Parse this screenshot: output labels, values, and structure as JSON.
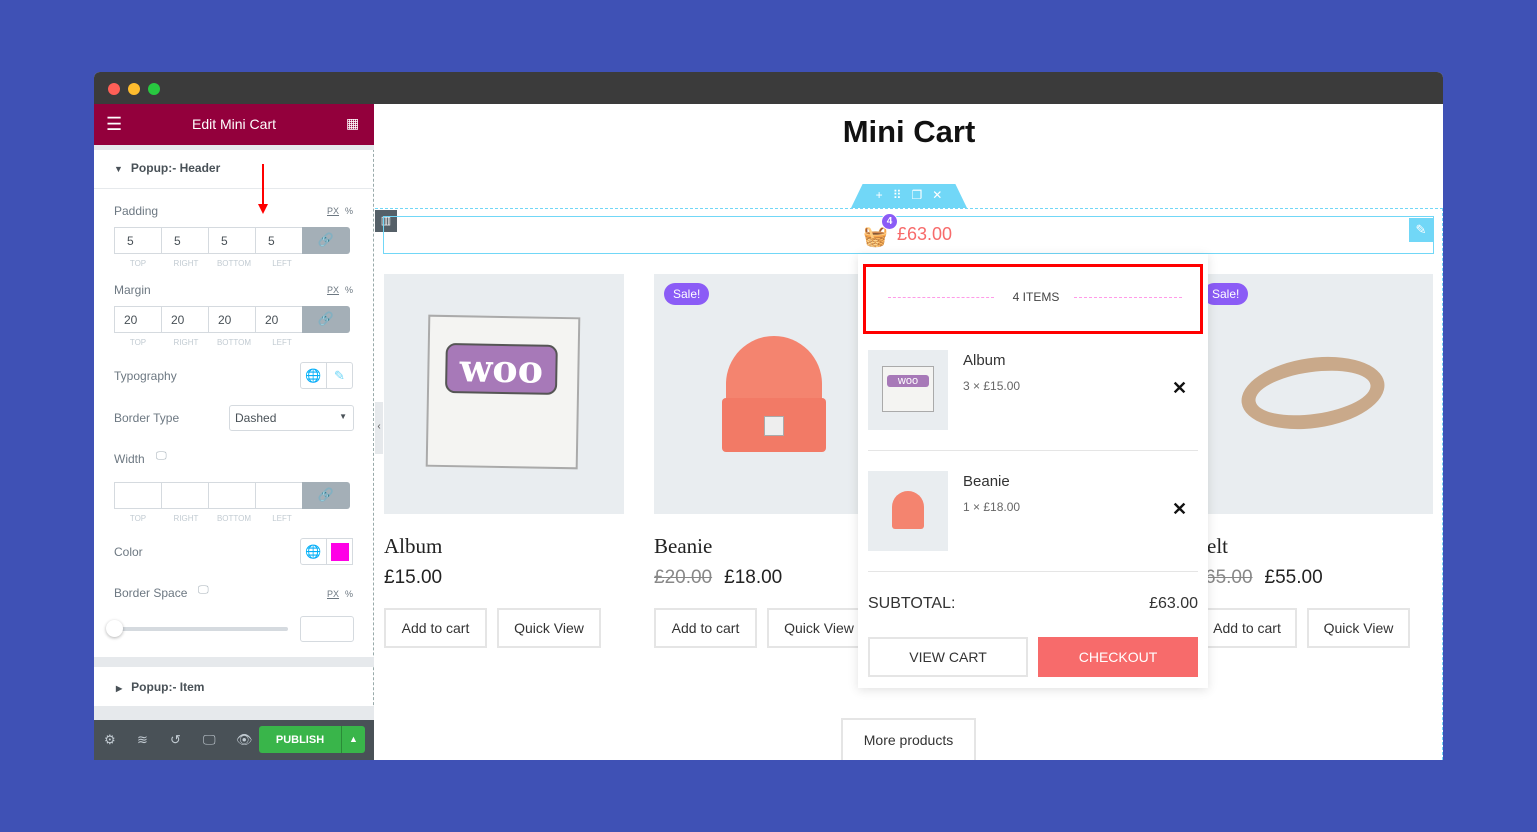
{
  "panel": {
    "title": "Edit Mini Cart",
    "section_header": "Popup:- Header",
    "section_item": "Popup:- Item",
    "padding": {
      "label": "Padding",
      "unit_px": "PX",
      "unit_pct": "%",
      "values": [
        "5",
        "5",
        "5",
        "5"
      ]
    },
    "margin": {
      "label": "Margin",
      "unit_px": "PX",
      "unit_pct": "%",
      "values": [
        "20",
        "20",
        "20",
        "20"
      ]
    },
    "sides": [
      "TOP",
      "RIGHT",
      "BOTTOM",
      "LEFT"
    ],
    "typography": "Typography",
    "border_type": {
      "label": "Border Type",
      "value": "Dashed"
    },
    "width": {
      "label": "Width"
    },
    "color": {
      "label": "Color",
      "value": "#ff00e6"
    },
    "border_space": {
      "label": "Border Space",
      "unit_px": "PX",
      "unit_pct": "%",
      "value": 0
    },
    "publish": "PUBLISH"
  },
  "page": {
    "title": "Mini Cart",
    "cart_count": "4",
    "cart_total": "£63.00",
    "more": "More products"
  },
  "products": [
    {
      "name": "Album",
      "price": "£15.00",
      "old": "",
      "sale": "",
      "add": "Add to cart",
      "qv": "Quick View"
    },
    {
      "name": "Beanie",
      "price": "£18.00",
      "old": "£20.00",
      "sale": "Sale!",
      "add": "Add to cart",
      "qv": "Quick View"
    },
    {
      "name": "elt",
      "price": "£55.00",
      "old": "65.00",
      "sale": "Sale!",
      "add": "Add to cart",
      "qv": "Quick View"
    }
  ],
  "popup": {
    "header": "4 ITEMS",
    "items": [
      {
        "name": "Album",
        "qty": "3 × £15.00"
      },
      {
        "name": "Beanie",
        "qty": "1 × £18.00"
      }
    ],
    "subtotal_label": "SUBTOTAL:",
    "subtotal": "£63.00",
    "view_cart": "VIEW CART",
    "checkout": "CHECKOUT"
  },
  "colors": {
    "panel_header": "#93003c",
    "accent": "#f76b6b",
    "badge": "#8b5cf6",
    "publish": "#39b54a"
  }
}
